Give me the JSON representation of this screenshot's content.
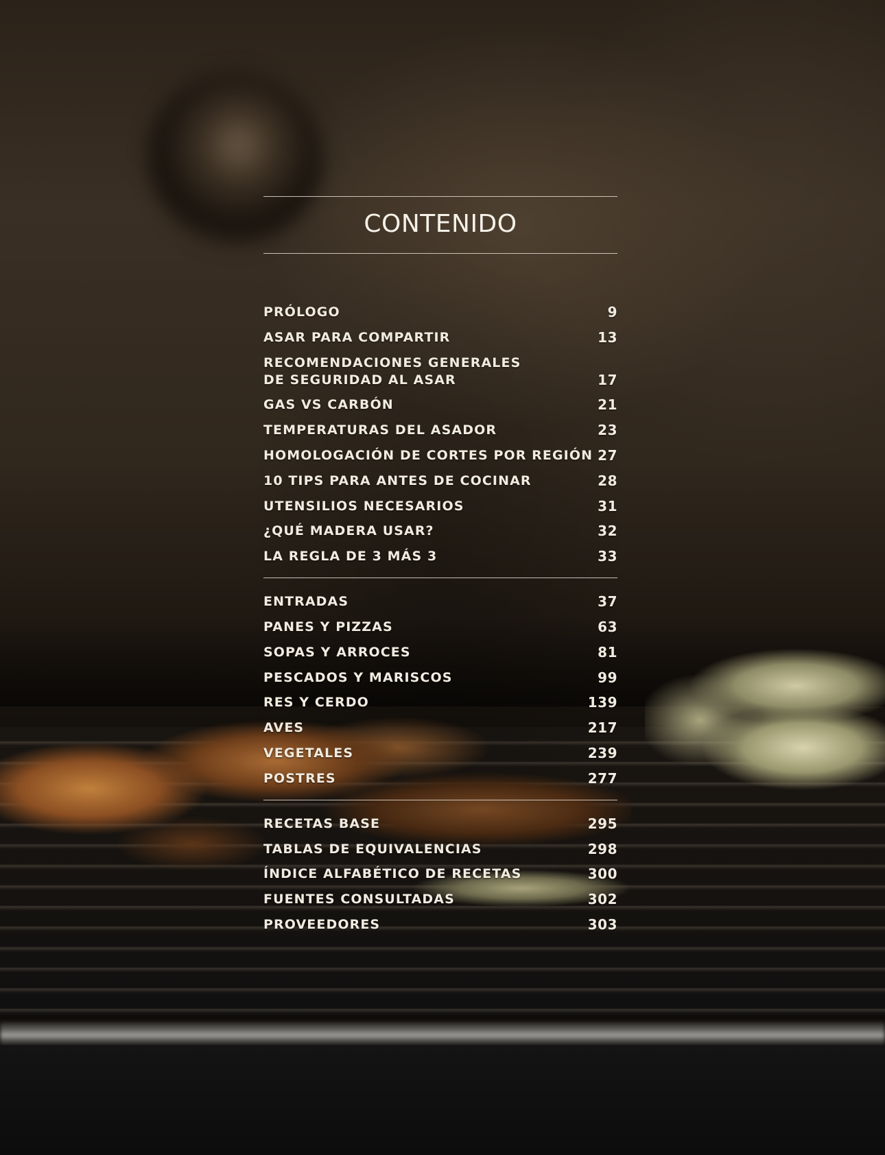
{
  "title": "CONTENIDO",
  "sections": [
    {
      "entries": [
        {
          "label": "PRÓLOGO",
          "page": "9"
        },
        {
          "label": "ASAR PARA COMPARTIR",
          "page": "13"
        },
        {
          "label": "RECOMENDACIONES GENERALES\nDE SEGURIDAD AL ASAR",
          "page": "17"
        },
        {
          "label": "GAS VS CARBÓN",
          "page": "21"
        },
        {
          "label": "TEMPERATURAS DEL ASADOR",
          "page": "23"
        },
        {
          "label": "HOMOLOGACIÓN DE CORTES POR REGIÓN",
          "page": "27"
        },
        {
          "label": "10 TIPS PARA ANTES DE COCINAR",
          "page": "28"
        },
        {
          "label": "UTENSILIOS NECESARIOS",
          "page": "31"
        },
        {
          "label": "¿QUÉ MADERA USAR?",
          "page": "32"
        },
        {
          "label": "LA REGLA DE 3 MÁS 3",
          "page": "33"
        }
      ]
    },
    {
      "entries": [
        {
          "label": "ENTRADAS",
          "page": "37"
        },
        {
          "label": "PANES Y PIZZAS",
          "page": "63"
        },
        {
          "label": "SOPAS Y ARROCES",
          "page": "81"
        },
        {
          "label": "PESCADOS Y MARISCOS",
          "page": "99"
        },
        {
          "label": "RES Y CERDO",
          "page": "139"
        },
        {
          "label": "AVES",
          "page": "217"
        },
        {
          "label": "VEGETALES",
          "page": "239"
        },
        {
          "label": "POSTRES",
          "page": "277"
        }
      ]
    },
    {
      "entries": [
        {
          "label": "RECETAS BASE",
          "page": "295"
        },
        {
          "label": "TABLAS DE EQUIVALENCIAS",
          "page": "298"
        },
        {
          "label": "ÍNDICE ALFABÉTICO DE RECETAS",
          "page": "300"
        },
        {
          "label": "FUENTES CONSULTADAS",
          "page": "302"
        },
        {
          "label": "PROVEEDORES",
          "page": "303"
        }
      ]
    }
  ]
}
